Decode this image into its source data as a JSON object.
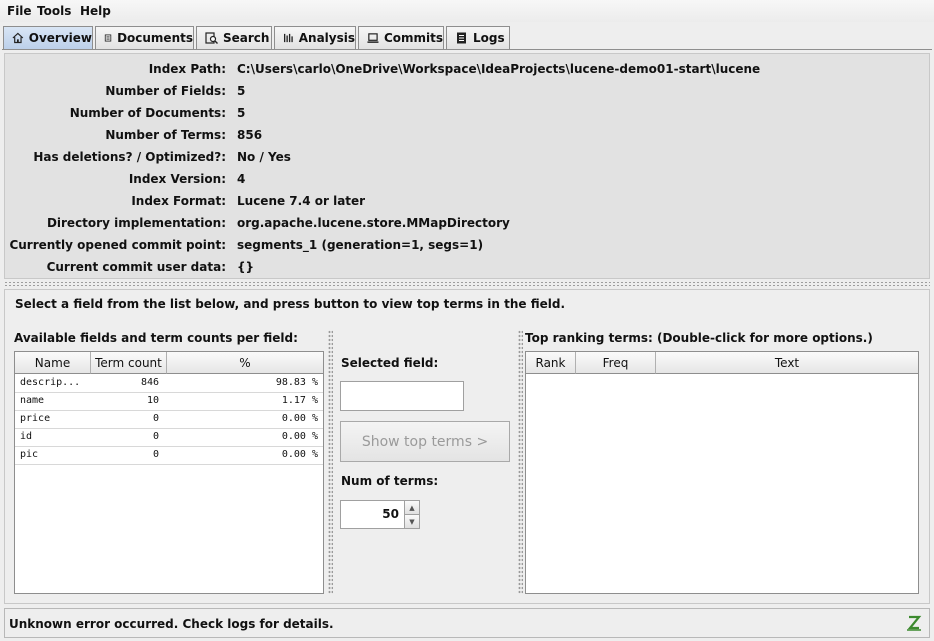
{
  "menu": [
    "File",
    "Tools",
    "Help"
  ],
  "tabs": [
    "Overview",
    "Documents",
    "Search",
    "Analysis",
    "Commits",
    "Logs"
  ],
  "overview": [
    {
      "label": "Index Path:",
      "value": "C:\\Users\\carlo\\OneDrive\\Workspace\\IdeaProjects\\lucene-demo01-start\\lucene"
    },
    {
      "label": "Number of Fields:",
      "value": "5"
    },
    {
      "label": "Number of Documents:",
      "value": "5"
    },
    {
      "label": "Number of Terms:",
      "value": "856"
    },
    {
      "label": "Has deletions? / Optimized?:",
      "value": "No / Yes"
    },
    {
      "label": "Index Version:",
      "value": "4"
    },
    {
      "label": "Index Format:",
      "value": "Lucene 7.4 or later"
    },
    {
      "label": "Directory implementation:",
      "value": "org.apache.lucene.store.MMapDirectory"
    },
    {
      "label": "Currently opened commit point:",
      "value": "segments_1 (generation=1, segs=1)"
    },
    {
      "label": "Current commit user data:",
      "value": "{}"
    }
  ],
  "instruction": "Select a field from the list below, and press button to view top terms in the field.",
  "fields_panel": {
    "title": "Available fields and term counts per field:",
    "columns": [
      "Name",
      "Term count",
      "%"
    ],
    "rows": [
      {
        "name": "descrip...",
        "count": "846",
        "pct": "98.83 %"
      },
      {
        "name": "name",
        "count": "10",
        "pct": "1.17 %"
      },
      {
        "name": "price",
        "count": "0",
        "pct": "0.00 %"
      },
      {
        "name": "id",
        "count": "0",
        "pct": "0.00 %"
      },
      {
        "name": "pic",
        "count": "0",
        "pct": "0.00 %"
      }
    ]
  },
  "middle_panel": {
    "selected_field_label": "Selected field:",
    "selected_field_value": "",
    "show_button": "Show top terms >",
    "num_terms_label": "Num of terms:",
    "num_terms_value": "50"
  },
  "terms_panel": {
    "title": "Top ranking terms: (Double-click for more options.)",
    "columns": [
      "Rank",
      "Freq",
      "Text"
    ]
  },
  "status": "Unknown error occurred. Check logs for details.",
  "icons": {
    "overview": "home-icon",
    "documents": "book-icon",
    "search": "search-doc-icon",
    "analysis": "analysis-icon",
    "commits": "laptop-icon",
    "logs": "log-icon",
    "status": "lucene-logo-icon"
  },
  "colors": {
    "active_tab": "#bcd0ea",
    "panel_bg": "#e2e2e2",
    "window_bg": "#eeeeee"
  }
}
